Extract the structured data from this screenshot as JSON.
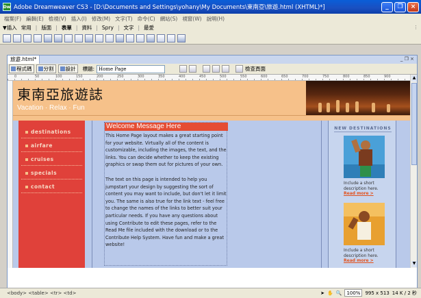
{
  "app": {
    "title": "Adobe Dreamweaver CS3 - [D:\\Documents and Settings\\yohany\\My Documents\\東南亞\\旅遊.html (XHTML)*]",
    "icon_label": "Dw"
  },
  "menu": [
    "檔案(F)",
    "編輯(E)",
    "檢視(V)",
    "插入(I)",
    "修改(M)",
    "文字(T)",
    "命令(C)",
    "網站(S)",
    "視窗(W)",
    "說明(H)"
  ],
  "insert_bar": {
    "label": "▼插入",
    "categories": [
      "常用",
      "版面",
      "表單",
      "資料",
      "Spry",
      "文字",
      "最愛"
    ],
    "active": "表單"
  },
  "document": {
    "tab": "旅遊.html*",
    "views": [
      "程式碼",
      "分割",
      "設計"
    ],
    "title_label": "標題:",
    "title_value": "Home Page",
    "check_page": "檢查頁面"
  },
  "ruler_marks": [
    "0",
    "50",
    "100",
    "150",
    "200",
    "250",
    "300",
    "350",
    "400",
    "450",
    "500",
    "550",
    "600",
    "650",
    "700",
    "750",
    "800",
    "850",
    "900"
  ],
  "page": {
    "site_title": "東南亞旅遊誌",
    "tagline": "Vacation · Relax · Fun",
    "nav": [
      "destinations",
      "airfare",
      "cruises",
      "specials",
      "contact"
    ],
    "welcome": "Welcome Message Here",
    "paragraphs": [
      "This Home Page layout makes a great starting point for your website. Virtually all of the content is customizable, including the images, the text, and the links. You can decide whether to keep the existing graphics or swap them out for pictures of your own.",
      "The text on this page is intended to help you jumpstart your design by suggesting the sort of content you may want to include, but don't let it limit you. The same is also true for the link text - feel free to change the names of the links to better suit your particular needs. If you have any questions about using Contribute to edit these pages, refer to the Read Me file included with the download or to the Contribute Help System. Have fun and make a great website!"
    ],
    "new_destinations": {
      "title": "NEW DESTINATIONS",
      "cards": [
        {
          "desc": "Include a short description here.",
          "link": "Read more >"
        },
        {
          "desc": "Include a short description here.",
          "link": "Read more >"
        }
      ]
    }
  },
  "status": {
    "tags": "<body> <table> <tr> <td>",
    "zoom": "100%",
    "dimensions": "995 x 513",
    "size": "14 K / 2 秒"
  }
}
